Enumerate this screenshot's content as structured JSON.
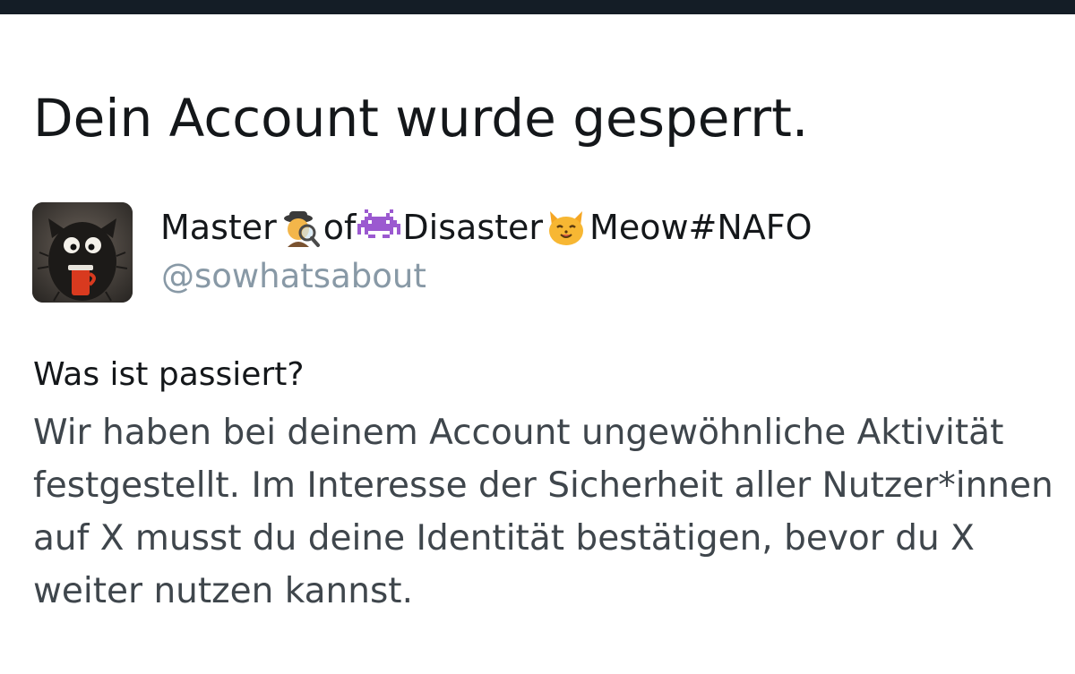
{
  "header": {
    "title": "Dein Account wurde gesperrt."
  },
  "profile": {
    "name_part1": "Master",
    "emoji1": "detective-icon",
    "name_part2": "of",
    "emoji2": "alien-monster-icon",
    "name_part3": "Disaster",
    "emoji3": "cat-face-icon",
    "name_part4": "Meow#NAFO",
    "handle": "@sowhatsabout"
  },
  "section": {
    "heading": "Was ist passiert?",
    "body": "Wir haben bei deinem Account ungewöhnliche Aktivität festgestellt. Im Interesse der Sicherheit aller Nutzer*innen auf X musst du deine Identität bestätigen, bevor du X weiter nutzen kannst."
  },
  "colors": {
    "top_bar": "#141d26",
    "text_primary": "#14171a",
    "text_body": "#3f464c",
    "handle": "#8899a6"
  }
}
